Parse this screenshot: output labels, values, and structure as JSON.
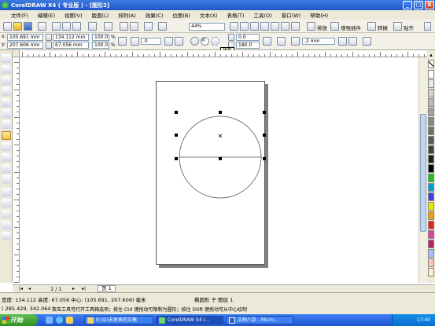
{
  "window": {
    "title": "CorelDRAW X4 ( 专业版 ) - [图形2]",
    "min": "_",
    "max": "□",
    "close": "X"
  },
  "menu": [
    "文件(F)",
    "编辑(E)",
    "视图(V)",
    "版面(L)",
    "排列(A)",
    "效果(C)",
    "位图(B)",
    "文本(X)",
    "表格(T)",
    "工具(O)",
    "窗口(W)",
    "帮助(H)"
  ],
  "toolbar1": {
    "zoom": "44%",
    "arrange": "排放",
    "plugin": "增强插件",
    "convert": "转换",
    "snap": "贴齐"
  },
  "toolbar2": {
    "x": "105.691 mm",
    "y": "207.606 mm",
    "w": "134.112 mm",
    "h": "67.056 mm",
    "sx": "100.0",
    "sy": "100.0",
    "pct": "%",
    "rotation": ".0",
    "start_angle": "0.0",
    "end_angle": "180.0",
    "outline": ".2 mm"
  },
  "tooltip": "饼形",
  "pagebar": {
    "page_count": "1 / 1",
    "page_tab": "页 1"
  },
  "status": {
    "line1": "宽度: 134.112 高度: 67.056 中心: (105.691, 207.606) 毫米",
    "layer": "椭圆形 于 图层 1",
    "coords": "( 285.429, 342.064 )",
    "hint": "双击工具可打开工具箱选项；按住 Ctrl 键拖动可限制为圆形；按住 Shift 键拖动可从中心绘制"
  },
  "taskbar": {
    "start": "开始",
    "tasks": [
      "E:\\以\\未发表的文稿",
      "CorelDRAW X4 (...",
      "文档八卦 - Micro..."
    ],
    "clock": "17:40"
  },
  "colors": {
    "palette": [
      "#ffffff",
      "#e8e8e8",
      "#d0d0d0",
      "#b8b8b8",
      "#a0a0a0",
      "#888888",
      "#707070",
      "#585858",
      "#404040",
      "#202020",
      "#000000",
      "#20c020",
      "#00a0e0",
      "#4040e0",
      "#e8e800",
      "#f0a000",
      "#e82020",
      "#e040a0",
      "#c01c60",
      "#a0c0ff",
      "#ffc0c0",
      "#fff0c0"
    ]
  }
}
